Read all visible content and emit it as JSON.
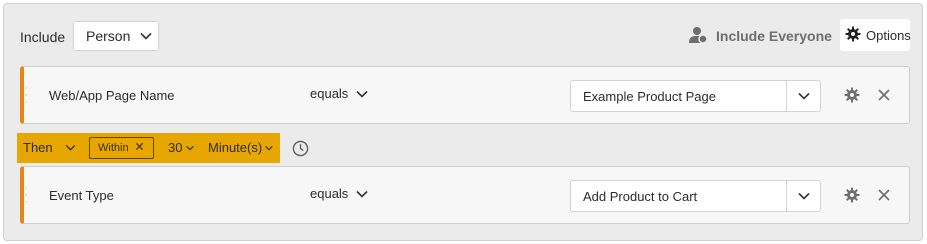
{
  "header": {
    "include_label": "Include",
    "scope_value": "Person",
    "include_everyone_label": "Include Everyone",
    "options_label": "Options"
  },
  "rules": [
    {
      "dimension": "Web/App Page Name",
      "operator": "equals",
      "value": "Example Product Page"
    },
    {
      "dimension": "Event Type",
      "operator": "equals",
      "value": "Add Product to Cart"
    }
  ],
  "sequence": {
    "then_label": "Then",
    "within_label": "Within",
    "amount": "30",
    "unit": "Minute(s)"
  },
  "icons": {
    "user": "user-icon",
    "gear": "gear-icon",
    "close": "close-icon",
    "chevron": "chevron-down-icon",
    "clock": "clock-icon"
  },
  "colors": {
    "accent_orange": "#e68619",
    "then_bar": "#e8a600",
    "panel_bg": "#ebebeb"
  }
}
